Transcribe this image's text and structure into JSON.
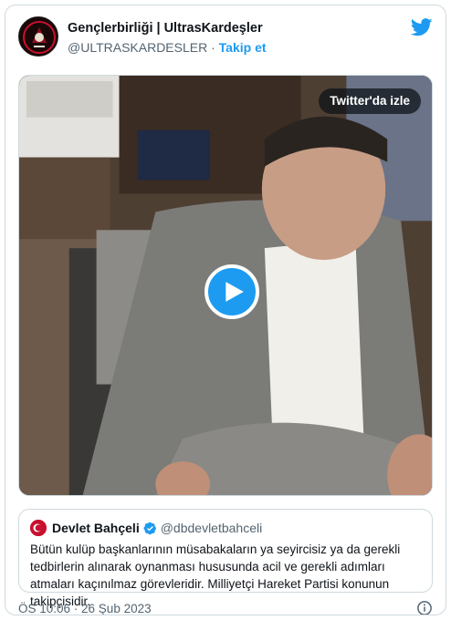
{
  "tweet": {
    "display_name": "Gençlerbirliği | UltrasKardeşler",
    "handle": "@ULTRASKARDESLER",
    "separator": "·",
    "follow_label": "Takip et",
    "timestamp": "ÖS 10:06 · 26 Şub 2023"
  },
  "media": {
    "watch_label": "Twitter'da izle"
  },
  "quoted": {
    "display_name": "Devlet Bahçeli",
    "handle": "@dbdevletbahceli",
    "text": "Bütün kulüp başkanlarının müsabakaların ya seyircisiz ya da gerekli tedbirlerin alınarak oynanması hususunda acil ve gerekli adımları atmaları kaçınılmaz görevleridir. Milliyetçi Hareket Partisi konunun takipçisidir."
  },
  "icons": {
    "brand": "twitter-bird-icon",
    "play": "play-icon",
    "verified": "verified-badge-icon",
    "info": "info-icon"
  },
  "colors": {
    "accent": "#1d9bf0",
    "text": "#0f1419",
    "muted": "#536471",
    "border": "#cfd9de"
  }
}
